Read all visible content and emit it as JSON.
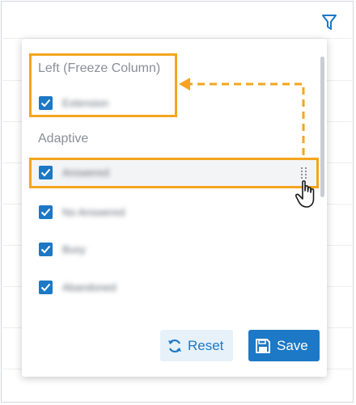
{
  "left_section": {
    "title": "Left (Freeze Column)",
    "items": [
      {
        "label": "Extension",
        "checked": true
      }
    ]
  },
  "adaptive_section": {
    "title": "Adaptive",
    "items": [
      {
        "label": "Answered",
        "checked": true
      },
      {
        "label": "No Answered",
        "checked": true
      },
      {
        "label": "Busy",
        "checked": true
      },
      {
        "label": "Abandoned",
        "checked": true
      }
    ]
  },
  "buttons": {
    "reset_label": "Reset",
    "save_label": "Save"
  },
  "colors": {
    "accent": "#1d78c5",
    "highlight": "#f4a51e",
    "muted_text": "#8a8f97",
    "reset_bg": "#e6f1fa"
  },
  "icons": {
    "filter": "filter-icon",
    "checkbox": "checkmark-icon",
    "drag": "drag-handle-icon",
    "cursor": "hand-pointer-icon",
    "reset": "refresh-icon",
    "save": "floppy-disk-icon"
  }
}
